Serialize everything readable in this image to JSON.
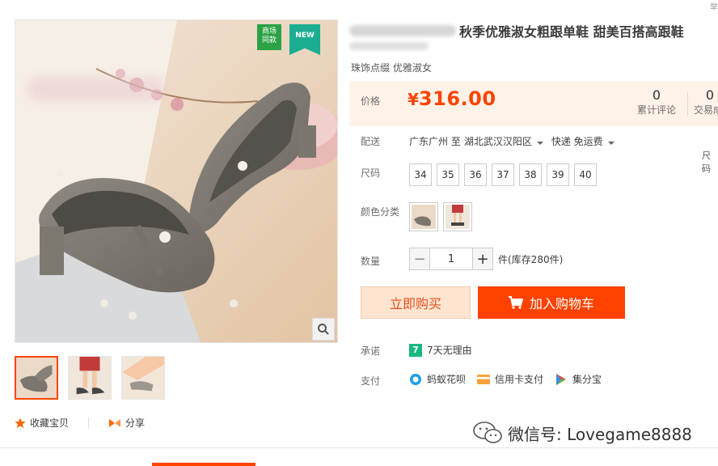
{
  "badges": {
    "mall_same": "商场\n同款",
    "new": "NEW"
  },
  "product": {
    "title": "秋季优雅淑女粗跟单鞋 甜美百搭高跟鞋",
    "subtitle": "珠饰点缀 优雅淑女"
  },
  "price": {
    "label": "价格",
    "currency": "¥",
    "value": "316.00",
    "reviews_count": "0",
    "reviews_label": "累计评论",
    "trades_count": "0",
    "trades_label": "交易成"
  },
  "shipping": {
    "label": "配送",
    "from": "广东广州 至",
    "to": "湖北武汉汉阳区",
    "method": "快递 免运费"
  },
  "sizes": {
    "label": "尺码",
    "options": [
      "34",
      "35",
      "36",
      "37",
      "38",
      "39",
      "40"
    ],
    "right_cut": "尺码"
  },
  "colors": {
    "label": "颜色分类"
  },
  "quantity": {
    "label": "数量",
    "minus": "−",
    "value": "1",
    "plus": "+",
    "stock": "件(库存280件)"
  },
  "buttons": {
    "buy_now": "立即购买",
    "add_cart": "加入购物车"
  },
  "promise": {
    "label": "承诺",
    "icon_text": "7",
    "text": "7天无理由"
  },
  "payment": {
    "label": "支付",
    "methods": [
      "蚂蚁花呗",
      "信用卡支付",
      "集分宝"
    ]
  },
  "actions": {
    "favorite": "收藏宝贝",
    "share": "分享"
  },
  "watermark": "微信号: Lovegame8888",
  "corner_cut": "举",
  "colors_theme": {
    "accent": "#ff4400",
    "price_bg": "#fff2e8"
  }
}
